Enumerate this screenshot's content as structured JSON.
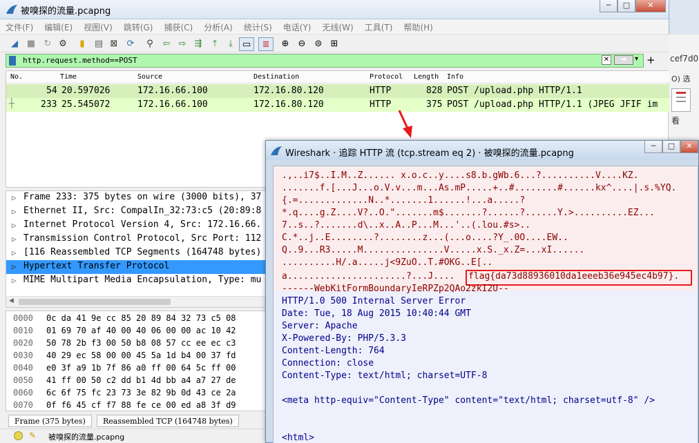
{
  "main_window": {
    "title": "被嗅探的流量.pcapng",
    "menu": [
      "文件(F)",
      "编辑(E)",
      "视图(V)",
      "跳转(G)",
      "捕获(C)",
      "分析(A)",
      "统计(S)",
      "电话(Y)",
      "无线(W)",
      "工具(T)",
      "帮助(H)"
    ],
    "filter": "http.request.method==POST",
    "columns": [
      "No.",
      "Time",
      "Source",
      "Destination",
      "Protocol",
      "Length",
      "Info"
    ],
    "packets": [
      {
        "no": "54",
        "time": "20.597026",
        "src": "172.16.66.100",
        "dst": "172.16.80.120",
        "proto": "HTTP",
        "len": "828",
        "info": "POST /upload.php HTTP/1.1"
      },
      {
        "no": "233",
        "time": "25.545072",
        "src": "172.16.66.100",
        "dst": "172.16.80.120",
        "proto": "HTTP",
        "len": "375",
        "info": "POST /upload.php HTTP/1.1  (JPEG JFIF im"
      }
    ],
    "details": [
      "Frame 233: 375 bytes on wire (3000 bits), 37",
      "Ethernet II, Src: CompalIn_32:73:c5 (20:89:8",
      "Internet Protocol Version 4, Src: 172.16.66.",
      "Transmission Control Protocol, Src Port: 112",
      "[116 Reassembled TCP Segments (164748 bytes)",
      "Hypertext Transfer Protocol",
      "MIME Multipart Media Encapsulation, Type: mu"
    ],
    "bytes": [
      {
        "off": "0000",
        "hex": "0c da 41 9e cc 85 20 89  84 32 73 c5 08"
      },
      {
        "off": "0010",
        "hex": "01 69 70 af 40 00 40 06  00 00 ac 10 42"
      },
      {
        "off": "0020",
        "hex": "50 78 2b f3 00 50 b8 08  57 cc ee ec c3"
      },
      {
        "off": "0030",
        "hex": "40 29 ec 58 00 00 45 5a  1d b4 00 37 fd"
      },
      {
        "off": "0040",
        "hex": "e0 3f a9 1b 7f 86 a0 ff  00 64 5c ff 00"
      },
      {
        "off": "0050",
        "hex": "41 ff 00 50 c2 dd b1 4d  bb a4 a7 27 de"
      },
      {
        "off": "0060",
        "hex": "6c 6f 75 fc 23 73 3e 82  9b 0d 43 ce 2a"
      },
      {
        "off": "0070",
        "hex": "0f f6 45 cf f7 88 fe ce  00 ed a8 3f d9"
      }
    ],
    "byte_tabs": [
      "Frame (375 bytes)",
      "Reassembled TCP (164748 bytes)"
    ],
    "status_file": "被嗅探的流量.pcapng"
  },
  "dialog": {
    "title": "Wireshark · 追踪 HTTP 流 (tcp.stream eq 2) · 被嗅探的流量.pcapng",
    "client_lines": [
      ".,..i7$..I.M..Z...... x.o.c..y....s8.b.gWb.6...?..........V....KZ.",
      ".......f.[...J...o.V.v...m...As.mP.....+..#........#......kx^....|.s.%YQ.",
      "{.=.............N..*.......1......!...a.....?",
      "*.q....g.Z....V?..O.\".......m$.......?......?......Y.>..........EZ...",
      "7..s..?.......d\\..x..A..P...M...'..(.lou.#s>..",
      "C.*..j..E........?........z...(...o....?Y_.0O....EW..",
      "Q..9...R3.....M...............V.....x.S._x.Z=...xI......",
      "..........H/.a.....j<9ZuO..T.#OKG..E[..",
      "a......................?...J....",
      "------WebKitFormBoundaryIeRPZp2QAo2zkI2U--"
    ],
    "flag": "flag{da73d88936010da1eeeb36e945ec4b97}.",
    "server_lines": [
      "HTTP/1.0 500 Internal Server Error",
      "Date: Tue, 18 Aug 2015 10:40:44 GMT",
      "Server: Apache",
      "X-Powered-By: PHP/5.3.3",
      "Content-Length: 764",
      "Connection: close",
      "Content-Type: text/html; charset=UTF-8",
      "",
      "<meta http-equiv=\"Content-Type\" content=\"text/html; charset=utf-8\" />",
      "",
      "",
      "<html>"
    ]
  },
  "background_window": {
    "text1": "cef7d0",
    "text2": "O)  选",
    "text3": "看"
  },
  "colors": {
    "filter_bg": "#aff7af",
    "row_bg": "#e4ffc7",
    "selected": "#3399ff",
    "highlight_box": "#e8191c"
  }
}
